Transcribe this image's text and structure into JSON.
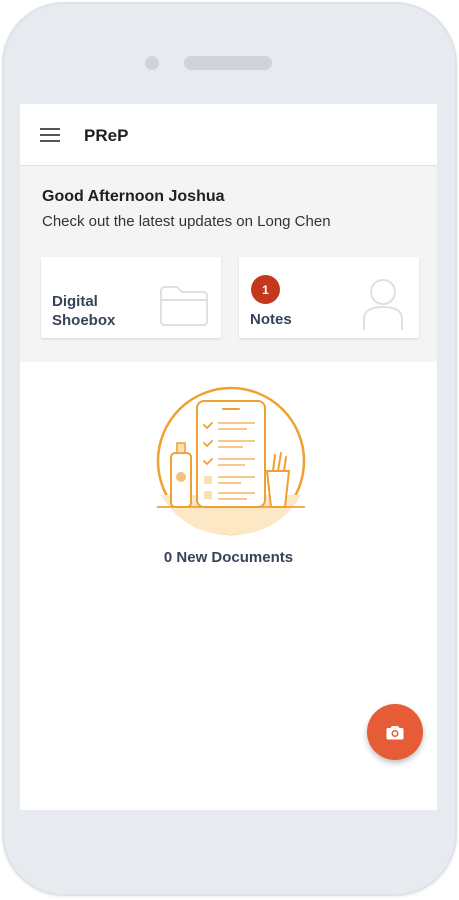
{
  "app": {
    "title": "PReP"
  },
  "header": {
    "greeting": "Good Afternoon Joshua",
    "subtitle": "Check out the latest updates on Long Chen"
  },
  "cards": {
    "shoebox": {
      "label_line1": "Digital",
      "label_line2": "Shoebox",
      "icon": "folder-icon"
    },
    "notes": {
      "label": "Notes",
      "badge_count": "1",
      "icon": "person-icon"
    }
  },
  "documents": {
    "status": "0 New Documents"
  },
  "fab": {
    "icon": "camera-icon"
  },
  "colors": {
    "accent": "#e65c36",
    "illustration": "#f0a030",
    "badge": "#c4381e",
    "label_text": "#36435a"
  }
}
